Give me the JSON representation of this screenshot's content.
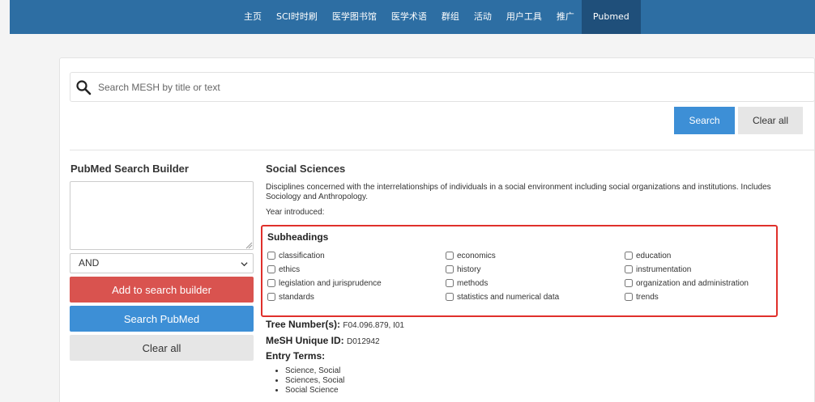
{
  "nav": {
    "items": [
      "主页",
      "SCI时时刷",
      "医学图书馆",
      "医学术语",
      "群组",
      "活动",
      "用户工具",
      "推广",
      "Pubmed"
    ],
    "active_index": 8
  },
  "search": {
    "placeholder": "Search MESH by title or text",
    "search_label": "Search",
    "clear_label": "Clear all"
  },
  "builder": {
    "title": "PubMed Search Builder",
    "operator": "AND",
    "add_label": "Add to search builder",
    "search_pubmed_label": "Search PubMed",
    "clear_label": "Clear all"
  },
  "term": {
    "title": "Social Sciences",
    "description": "Disciplines concerned with the interrelationships of individuals in a social environment including social organizations and institutions. Includes Sociology and Anthropology.",
    "year_introduced": "Year introduced:"
  },
  "subheadings": {
    "title": "Subheadings",
    "items": [
      "classification",
      "economics",
      "education",
      "ethics",
      "history",
      "instrumentation",
      "legislation and jurisprudence",
      "methods",
      "organization and administration",
      "standards",
      "statistics and numerical data",
      "trends"
    ]
  },
  "details": {
    "tree_label": "Tree Number(s):",
    "tree_value": "F04.096.879, I01",
    "mesh_label": "MeSH Unique ID:",
    "mesh_value": "D012942",
    "entry_label": "Entry Terms:",
    "entry_terms": [
      "Science, Social",
      "Sciences, Social",
      "Social Science"
    ]
  },
  "colors": {
    "nav_bg": "#2d6ea3",
    "primary": "#3d8fd6",
    "danger": "#d9534f",
    "highlight_border": "#e0302b"
  }
}
